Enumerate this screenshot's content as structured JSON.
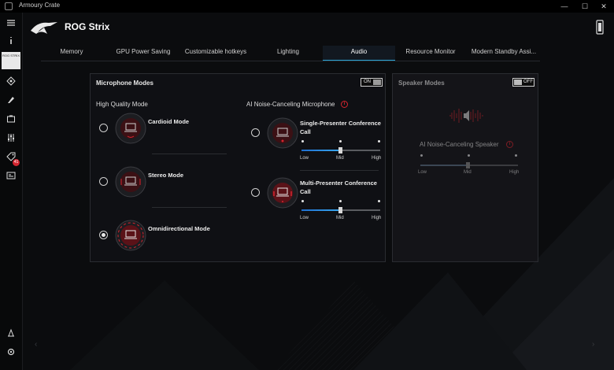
{
  "window": {
    "app_title": "Armoury Crate",
    "minimize": "—",
    "maximize": "☐",
    "close": "✕"
  },
  "header": {
    "title": "ROG Strix"
  },
  "sidebar": {
    "device_label": "ROG STRIX",
    "badge_count": "41"
  },
  "tabs": [
    {
      "label": "Memory"
    },
    {
      "label": "GPU Power Saving"
    },
    {
      "label": "Customizable hotkeys"
    },
    {
      "label": "Lighting"
    },
    {
      "label": "Audio"
    },
    {
      "label": "Resource Monitor"
    },
    {
      "label": "Modern Standby Assi..."
    }
  ],
  "active_tab": "Audio",
  "microphone": {
    "title": "Microphone Modes",
    "toggle": "ON",
    "high_quality": {
      "heading": "High Quality Mode",
      "modes": [
        {
          "label": "Cardioid Mode",
          "selected": false
        },
        {
          "label": "Stereo Mode",
          "selected": false
        },
        {
          "label": "Omnidirectional Mode",
          "selected": true
        }
      ]
    },
    "ai_noise": {
      "heading": "AI Noise-Canceling Microphone",
      "modes": [
        {
          "label_line1": "Single-Presenter Conference",
          "label_line2": "Call",
          "level": "Mid",
          "ticks": [
            "Low",
            "Mid",
            "High"
          ]
        },
        {
          "label_line1": "Multi-Presenter Conference",
          "label_line2": "Call",
          "level": "Mid",
          "ticks": [
            "Low",
            "Mid",
            "High"
          ]
        }
      ]
    }
  },
  "speaker": {
    "title": "Speaker Modes",
    "toggle": "OFF",
    "ai_noise": {
      "heading": "AI Noise-Canceling Speaker",
      "level": "Mid",
      "ticks": [
        "Low",
        "Mid",
        "High"
      ]
    }
  },
  "colors": {
    "accent_red": "#d4252f",
    "accent_blue": "#2aa6d6",
    "background": "#0b0c0e"
  }
}
